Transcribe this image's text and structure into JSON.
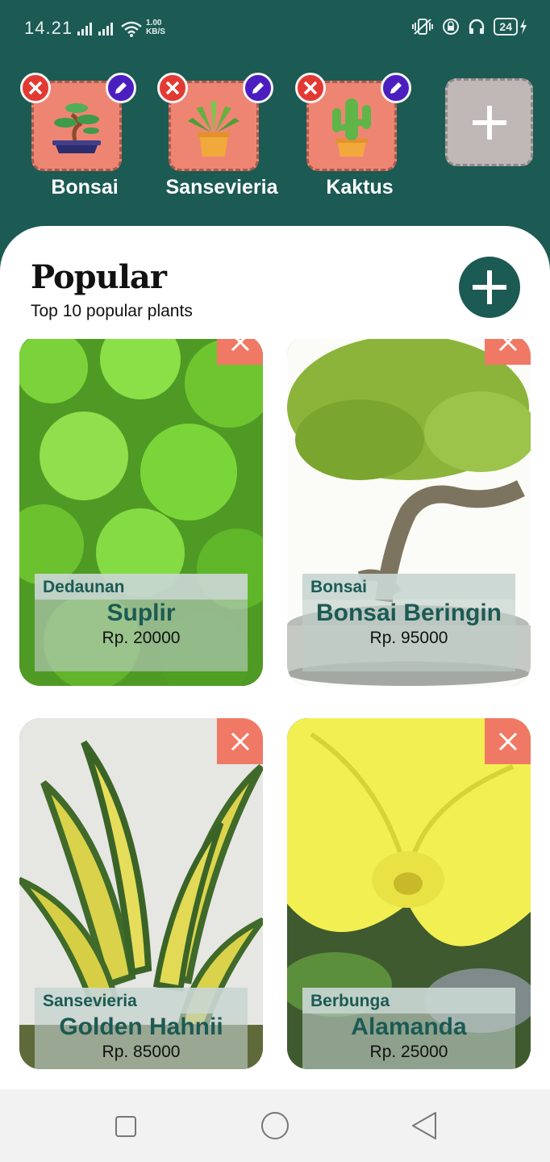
{
  "status_bar": {
    "time": "14.21",
    "net_speed_value": "1.00",
    "net_speed_unit": "KB/S",
    "battery": "24"
  },
  "categories": [
    {
      "label": "Bonsai",
      "icon": "bonsai-pot-icon"
    },
    {
      "label": "Sansevieria",
      "icon": "succulent-pot-icon"
    },
    {
      "label": "Kaktus",
      "icon": "cactus-pot-icon"
    }
  ],
  "section": {
    "title": "Popular",
    "subtitle": "Top 10 popular plants"
  },
  "plants": [
    {
      "category": "Dedaunan",
      "name": "Suplir",
      "price": "Rp. 20000"
    },
    {
      "category": "Bonsai",
      "name": "Bonsai Beringin",
      "price": "Rp. 95000"
    },
    {
      "category": "Sansevieria",
      "name": "Golden Hahnii",
      "price": "Rp. 85000"
    },
    {
      "category": "Berbunga",
      "name": "Alamanda",
      "price": "Rp. 25000"
    }
  ],
  "colors": {
    "header_bg": "#1c5a54",
    "category_tile": "#ee8573",
    "delete_red": "#e23a33",
    "edit_purple": "#4b1ec0",
    "card_delete": "#f07966"
  }
}
